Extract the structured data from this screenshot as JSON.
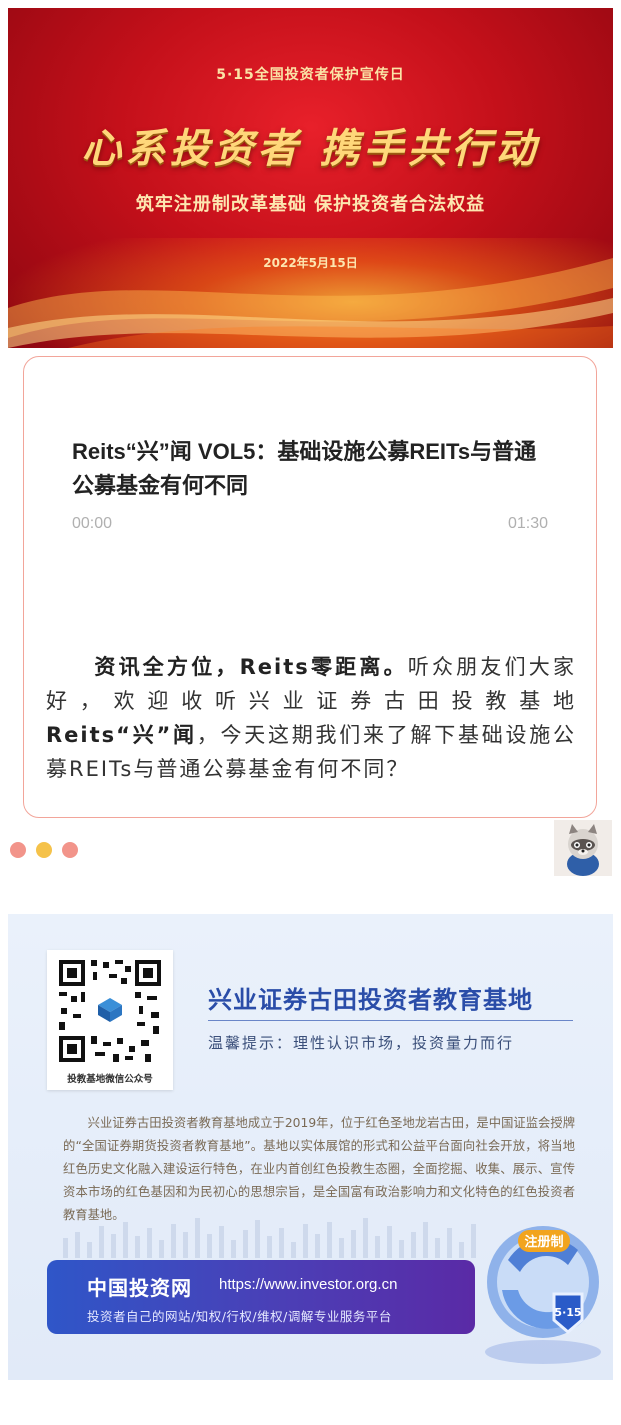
{
  "banner": {
    "subtitle": "5·15全国投资者保护宣传日",
    "headline": "心系投资者  携手共行动",
    "slogan": "筑牢注册制改革基础  保护投资者合法权益",
    "date": "2022年5月15日"
  },
  "audio": {
    "title": "Reits“兴”闻 VOL5：基础设施公募REITs与普通公募基金有何不同",
    "time_start": "00:00",
    "time_end": "01:30"
  },
  "intro": {
    "bold_1": "资讯全方位，Reits零距离。",
    "text_1": "听众朋友们大家好，欢迎收听兴业证券古田投教基地",
    "bold_2": "Reits“兴”闻",
    "text_2": "，今天这期我们来了解下基础设施公募REITs与普通公募基金有何不同？"
  },
  "dots": {
    "colors": [
      "#f2948a",
      "#f5c24a",
      "#f2948a"
    ]
  },
  "footer": {
    "qr_caption": "投教基地微信公众号",
    "org_name": "兴业证券古田投资者教育基地",
    "tip": "温馨提示：理性认识市场，投资量力而行",
    "description": "兴业证券古田投资者教育基地成立于2019年，位于红色圣地龙岩古田，是中国证监会授牌的“全国证券期货投资者教育基地”。基地以实体展馆的形式和公益平台面向社会开放，将当地红色历史文化融入建设运行特色，在业内首创红色投教生态圈，全面挖掘、收集、展示、宣传资本市场的红色基因和为民初心的思想宗旨，是全国富有政治影响力和文化特色的红色投资者教育基地。",
    "invest_title": "中国投资网",
    "invest_url": "https://www.investor.org.cn",
    "invest_sub": "投资者自己的网站/知权/行权/维权/调解专业服务平台",
    "badge_text": "注册制",
    "badge_date": "5·15"
  }
}
